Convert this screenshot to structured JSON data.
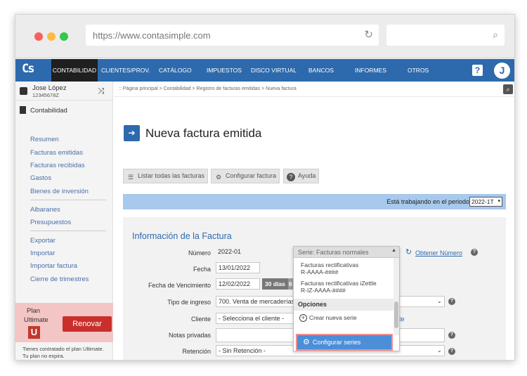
{
  "browser": {
    "url": "https://www.contasimple.com",
    "dot_colors": [
      "#fc605c",
      "#fdbc40",
      "#34c84a"
    ],
    "reload_icon": "reload-icon",
    "search_icon": "search-icon"
  },
  "app": {
    "logo_text": "Cs",
    "nav": [
      "CONTABILIDAD",
      "CLIENTES/PROV.",
      "CATÁLOGO",
      "IMPUESTOS",
      "DISCO VIRTUAL",
      "BANCOS",
      "INFORMES",
      "OTROS"
    ],
    "help_icon": "?",
    "avatar_initial": "J",
    "accent_color": "#2d6aad"
  },
  "user": {
    "name": "Jose López",
    "id": "12345678Z"
  },
  "sidebar": {
    "section_title": "Contabilidad",
    "items": [
      "Resumen",
      "Facturas emitidas",
      "Facturas recibidas",
      "Gastos",
      "Bienes de inversión"
    ],
    "items2": [
      "Albaranes",
      "Presupuestos"
    ],
    "items3": [
      "Exportar",
      "Importar",
      "Importar factura",
      "Cierre de trimestres"
    ],
    "plan": {
      "label": "Plan",
      "name": "Ultimate",
      "badge": "U",
      "renew": "Renovar",
      "info_line1": "Tienes contratado el plan Ultimate.",
      "info_line2": "Tu plan no expira."
    }
  },
  "main": {
    "breadcrumb": ":: Página principal > Contabilidad > Registro de facturas emitidas > Nueva factura",
    "title": "Nueva factura emitida",
    "toolbar": {
      "list_all": "Listar todas las facturas",
      "configure": "Configurar factura",
      "help": "Ayuda"
    },
    "period_text": "Está trabajando en el periodo",
    "period_value": "2022-1T",
    "card_title": "Información de la Factura",
    "form": {
      "numero_label": "Número",
      "numero_value": "2022-01",
      "serie_value": "Serie: Facturas normales",
      "obtener": "Obtener Número",
      "fecha_label": "Fecha",
      "fecha_value": "13/01/2022",
      "vencimiento_label": "Fecha de Vencimiento",
      "vencimiento_value": "12/02/2022",
      "dias": "30 días",
      "dias_cut": "6",
      "tipo_label": "Tipo de ingreso",
      "tipo_value": "700. Venta de mercaderías",
      "cliente_label": "Cliente",
      "cliente_value": "- Selecciona el cliente -",
      "cliente_link_tail": "te",
      "notas_label": "Notas privadas",
      "retencion_label": "Retención",
      "retencion_value": "- Sin Retención -"
    },
    "dropdown": {
      "header": "Serie: Facturas normales",
      "item1_line1": "Facturas rectificativas",
      "item1_line2": "R-AAAA-####",
      "item2_line1": "Facturas rectificativas iZettle",
      "item2_line2": "R-IZ-AAAA-####",
      "section": "Opciones",
      "create": "Crear nueva serie",
      "configure": "Configurar series"
    }
  }
}
